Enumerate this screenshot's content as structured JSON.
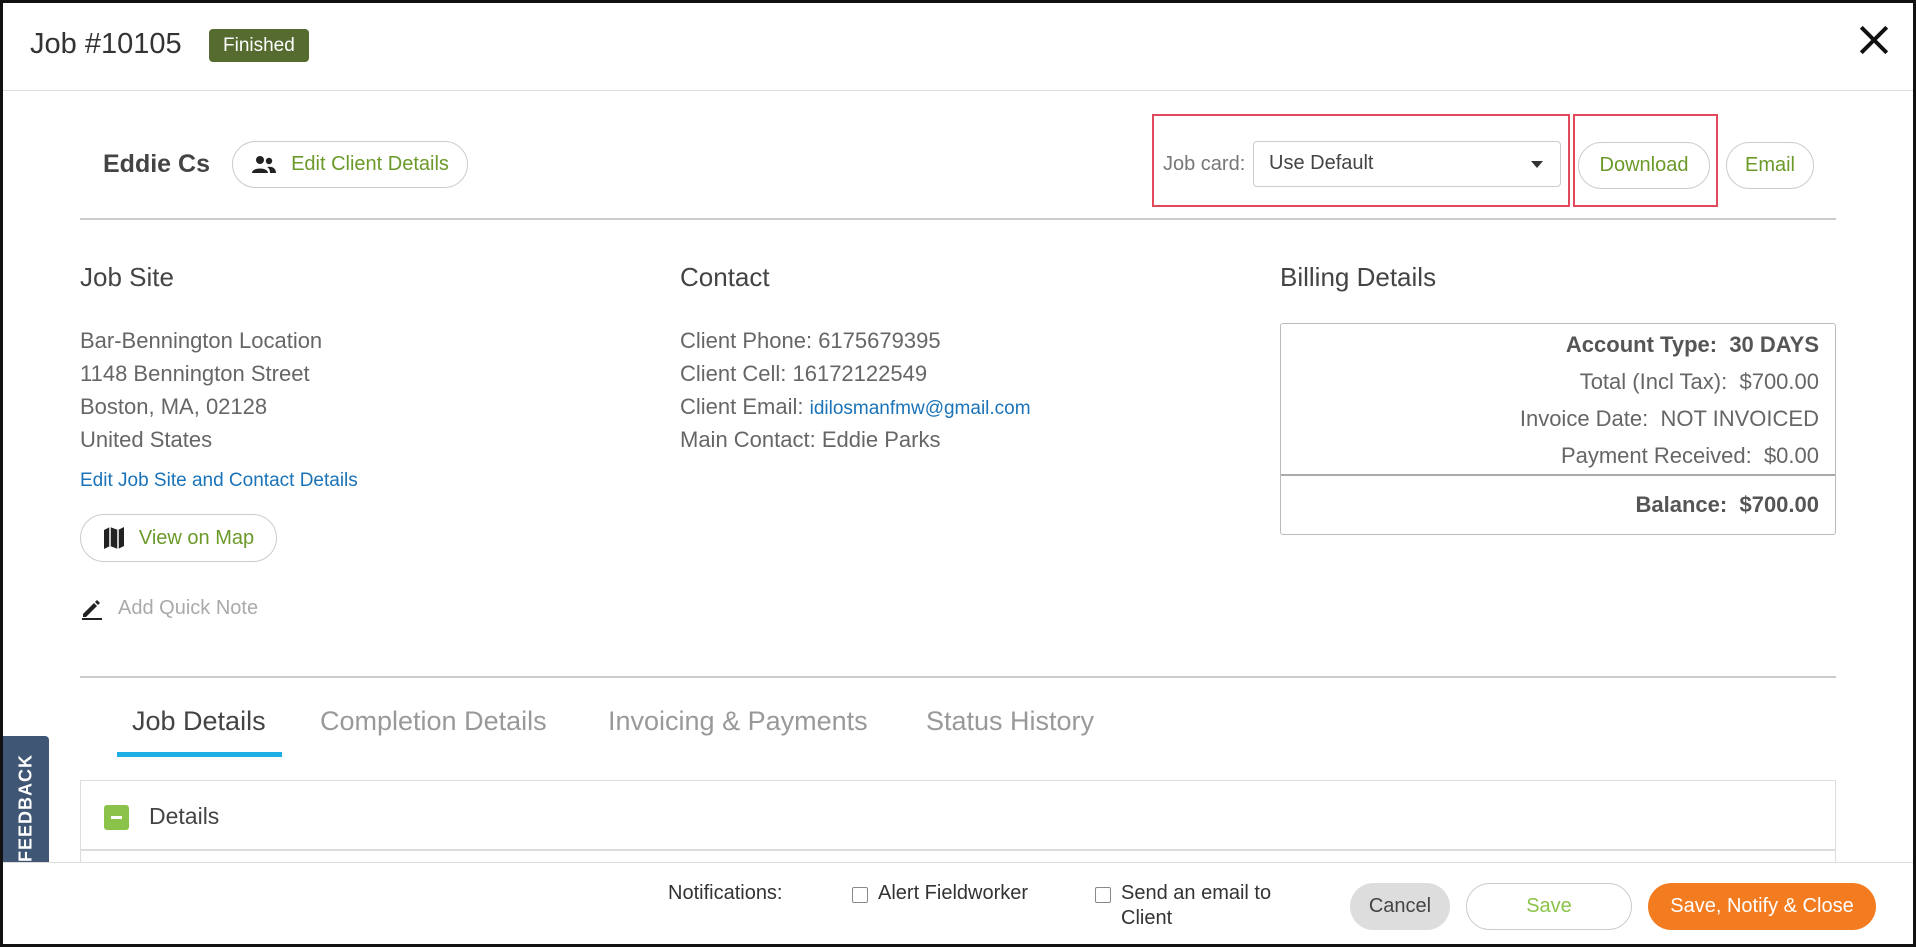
{
  "header": {
    "title": "Job #10105",
    "status": "Finished"
  },
  "client": {
    "name": "Eddie Cs",
    "edit_label": "Edit Client Details"
  },
  "job_card": {
    "label": "Job card:",
    "selected": "Use Default",
    "download_label": "Download",
    "email_label": "Email"
  },
  "job_site": {
    "title": "Job Site",
    "lines": [
      "Bar-Bennington Location",
      "1148 Bennington Street",
      "Boston, MA, 02128",
      "United States"
    ],
    "edit_link": "Edit Job Site and Contact Details",
    "map_label": "View on Map",
    "quick_note": "Add Quick Note"
  },
  "contact": {
    "title": "Contact",
    "phone": "Client Phone: 6175679395",
    "cell": "Client Cell: 16172122549",
    "email_label": "Client Email:",
    "email_value": "idilosmanfmw@gmail.com",
    "main_contact": "Main Contact: Eddie Parks"
  },
  "billing": {
    "title": "Billing Details",
    "account_type_label": "Account Type:",
    "account_type_value": "30 DAYS",
    "total_label": "Total (Incl Tax):",
    "total_value": "$700.00",
    "invoice_date_label": "Invoice Date:",
    "invoice_date_value": "NOT INVOICED",
    "payment_label": "Payment Received:",
    "payment_value": "$0.00",
    "balance_label": "Balance:",
    "balance_value": "$700.00"
  },
  "tabs": [
    {
      "label": "Job Details",
      "active": true
    },
    {
      "label": "Completion Details",
      "active": false
    },
    {
      "label": "Invoicing & Payments",
      "active": false
    },
    {
      "label": "Status History",
      "active": false
    }
  ],
  "details_panel": {
    "label": "Details"
  },
  "feedback": "FEEDBACK",
  "footer": {
    "notifications_label": "Notifications:",
    "alert_fieldworker": "Alert Fieldworker",
    "send_email": "Send an email to Client",
    "cancel": "Cancel",
    "save": "Save",
    "save_notify_close": "Save, Notify & Close"
  },
  "colors": {
    "status_badge": "#556b2f",
    "accent_green": "#6b9a2a",
    "link_blue": "#1a73b8",
    "tab_underline": "#1eaee6",
    "primary_orange": "#f47c20",
    "highlight_red": "#e04a5a"
  }
}
